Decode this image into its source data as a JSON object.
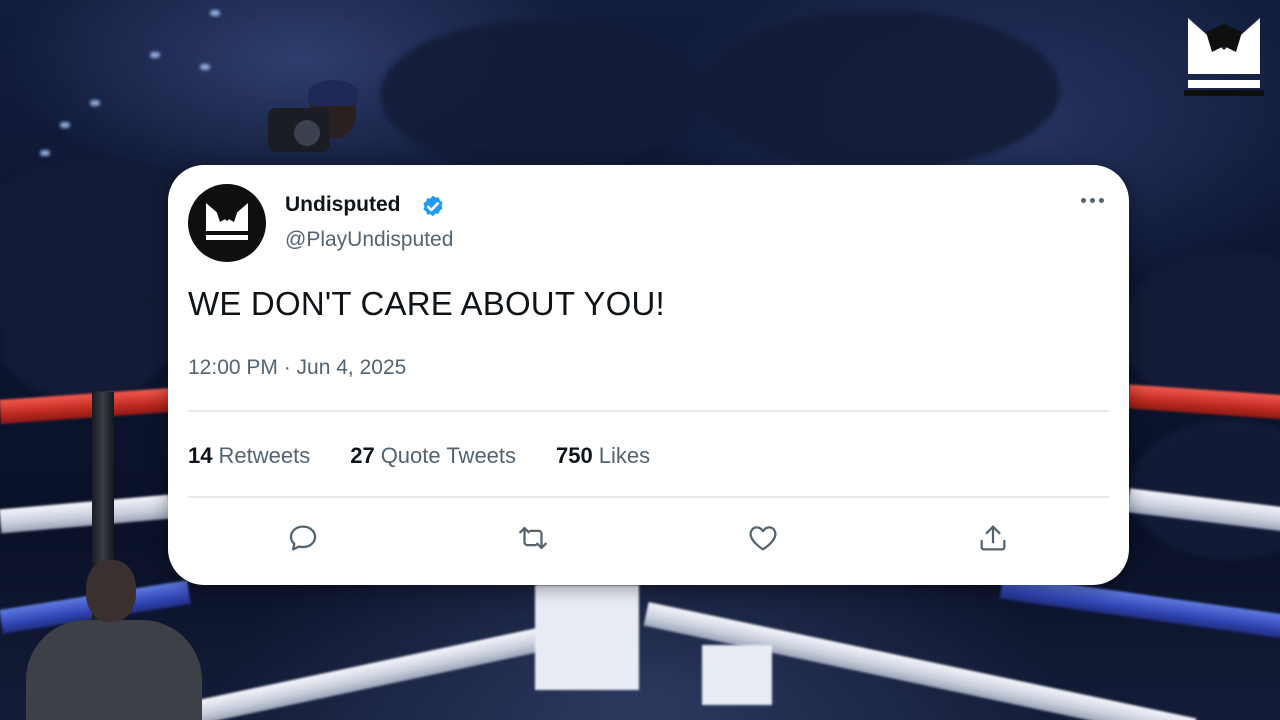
{
  "tweet": {
    "display_name": "Undisputed",
    "handle": "@PlayUndisputed",
    "text": "WE DON'T CARE ABOUT YOU!",
    "timestamp": "12:00 PM · Jun 4, 2025",
    "stats": [
      {
        "count": "14",
        "label": "Retweets"
      },
      {
        "count": "27",
        "label": "Quote Tweets"
      },
      {
        "count": "750",
        "label": "Likes"
      }
    ],
    "actions": [
      "reply-icon",
      "retweet-icon",
      "like-icon",
      "share-icon"
    ]
  },
  "colors": {
    "verified": "#1d9bf0",
    "text_primary": "#0f1419",
    "text_secondary": "#536471",
    "card_background": "#ffffff"
  },
  "brand_logo": "undisputed-crown-logo"
}
